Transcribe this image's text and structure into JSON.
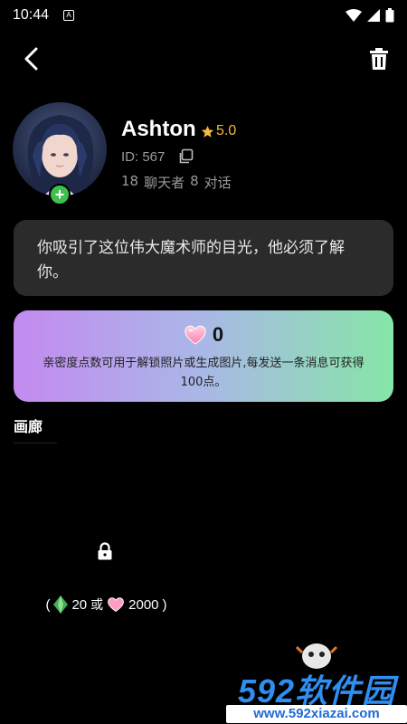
{
  "status_bar": {
    "time": "10:44",
    "notification_letter": "A"
  },
  "profile": {
    "name": "Ashton",
    "rating": "5.0",
    "id_text": "ID: 567",
    "chatters_count": "18",
    "chatters_label": "聊天者",
    "dialogs_count": "8",
    "dialogs_label": "对话"
  },
  "intro": {
    "text": "你吸引了这位伟大魔术师的目光，他必须了解你。"
  },
  "intimacy": {
    "points": "0",
    "description": "亲密度点数可用于解锁照片或生成图片,每发送一条消息可获得100点。"
  },
  "gallery": {
    "title": "画廊",
    "items": [
      {
        "open_paren": "(",
        "gem_cost": "20",
        "or_label": "或",
        "heart_cost": "2000",
        "close_paren": ")"
      }
    ]
  },
  "watermark": {
    "brand": "592软件园",
    "url": "www.592xiazai.com"
  },
  "colors": {
    "accent_star": "#f5b942",
    "add_badge": "#3fbf4f",
    "card_bg": "#2b2b2b",
    "gradient_start": "#c38af0",
    "gradient_end": "#86e6a7",
    "watermark_blue": "#2f8ef0"
  },
  "icons": {
    "back": "chevron-left-icon",
    "delete": "trash-icon",
    "rating": "star-icon",
    "copy": "copy-icon",
    "add": "plus-icon",
    "points": "heart-icon",
    "locked": "lock-icon",
    "gem": "gem-icon"
  }
}
